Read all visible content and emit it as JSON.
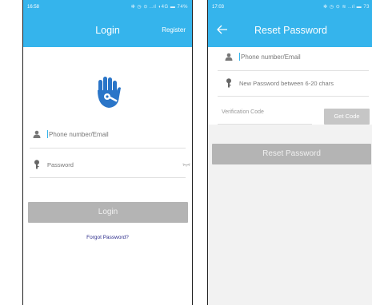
{
  "login_screen": {
    "status_time": "16:58",
    "status_icons": "✻ ◷ ⊙ ..ıl ◖4G ▬ 74%",
    "title": "Login",
    "register_label": "Register",
    "phone_placeholder": "Phone number/Email",
    "password_placeholder": "Password",
    "login_button": "Login",
    "forgot_password": "Forgot Password?"
  },
  "reset_screen": {
    "status_time": "17:03",
    "status_icons": "✻ ◷ ⊙ ≋ ..ıl ▬ 73",
    "title": "Reset Password",
    "phone_placeholder": "Phone number/Email",
    "new_password_placeholder": "New Password between 6-20 chars",
    "verification_placeholder": "Verification Code",
    "get_code_button": "Get Code",
    "reset_button": "Reset Password"
  },
  "colors": {
    "header": "#35b4ec",
    "disabled_button": "#b4b4b4",
    "logo": "#2a75c8"
  },
  "icons": [
    "person-icon",
    "key-icon",
    "eye-icon",
    "back-arrow-icon",
    "hand-key-logo"
  ]
}
